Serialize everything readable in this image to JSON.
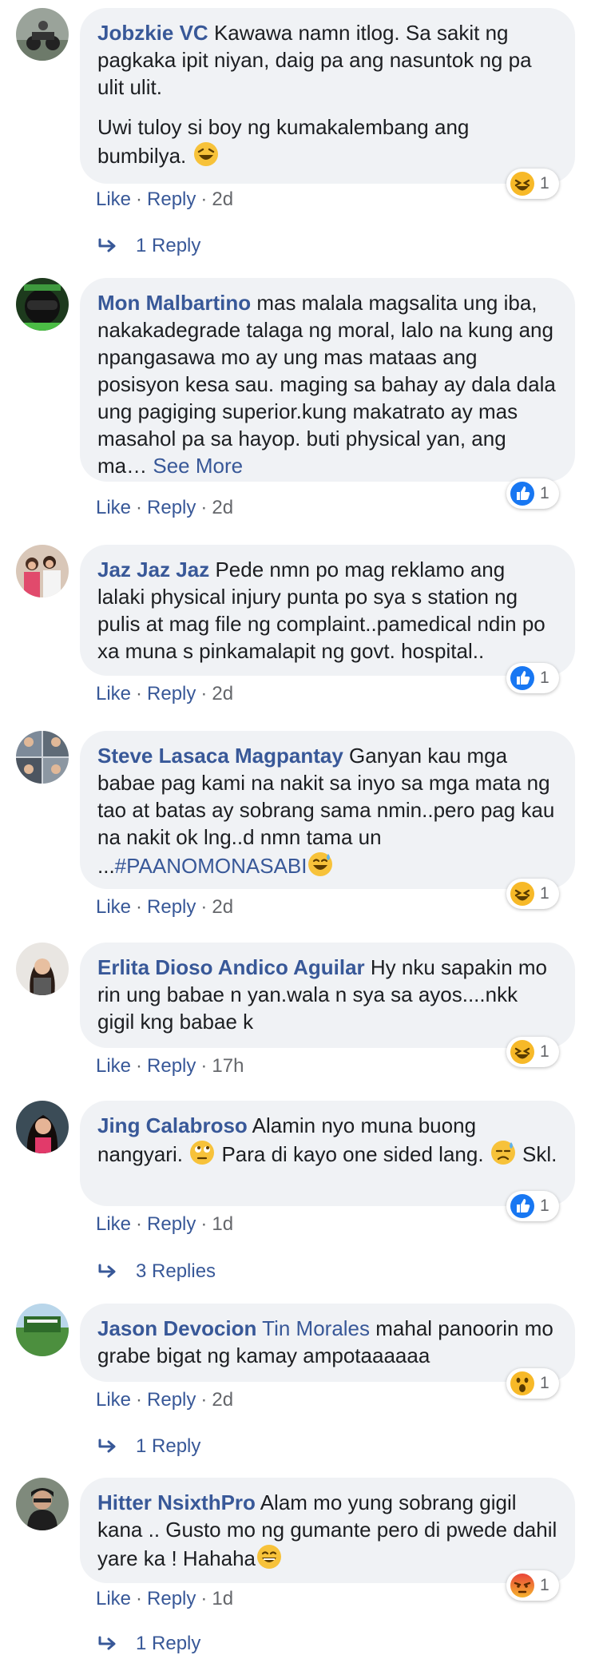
{
  "comments": [
    {
      "author": "Jobzkie VC",
      "mention": "",
      "text": "Kawawa namn itlog. Sa sakit ng pagkaka ipit niyan, daig pa ang nasuntok ng pa ulit ulit.",
      "text2": "Uwi tuloy si boy ng kumakalembang ang bumbilya.",
      "see_more": "",
      "like": "Like",
      "reply": "Reply",
      "time": "2d",
      "reaction": {
        "type": "haha",
        "count": "1"
      },
      "replies": "1 Reply"
    },
    {
      "author": "Mon Malbartino",
      "mention": "",
      "text": "mas malala magsalita ung iba, nakakadegrade talaga ng moral, lalo na kung ang npangasawa mo ay ung mas mataas ang posisyon kesa sau. maging sa bahay ay dala dala ung pagiging superior.kung makatrato ay mas masahol pa sa hayop. buti physical yan, ang ma…",
      "see_more": "See More",
      "like": "Like",
      "reply": "Reply",
      "time": "2d",
      "reaction": {
        "type": "like",
        "count": "1"
      },
      "replies": ""
    },
    {
      "author": "Jaz Jaz Jaz",
      "mention": "",
      "text": "Pede nmn po mag reklamo ang lalaki physical injury punta po sya s station ng pulis at mag file ng complaint..pamedical ndin po xa muna s pinkamalapit ng govt. hospital..",
      "see_more": "",
      "like": "Like",
      "reply": "Reply",
      "time": "2d",
      "reaction": {
        "type": "like",
        "count": "1"
      },
      "replies": ""
    },
    {
      "author": "Steve Lasaca Magpantay",
      "mention": "",
      "text": "Ganyan kau mga babae pag kami na nakit sa inyo sa mga mata ng tao at batas ay sobrang sama nmin..pero pag kau na nakit ok lng..d nmn tama un ...",
      "hashtag": "#PAANOMONASABI",
      "see_more": "",
      "like": "Like",
      "reply": "Reply",
      "time": "2d",
      "reaction": {
        "type": "haha",
        "count": "1"
      },
      "replies": ""
    },
    {
      "author": "Erlita Dioso Andico Aguilar",
      "mention": "",
      "text": "Hy nku sapakin mo rin ung babae n yan.wala n sya sa ayos....nkk gigil kng babae k",
      "see_more": "",
      "like": "Like",
      "reply": "Reply",
      "time": "17h",
      "reaction": {
        "type": "haha",
        "count": "1"
      },
      "replies": ""
    },
    {
      "author": "Jing Calabroso",
      "mention": "",
      "text_a": "Alamin nyo muna buong nangyari.",
      "text_b": "Para di kayo one sided lang.",
      "text_c": "Skl.",
      "see_more": "",
      "like": "Like",
      "reply": "Reply",
      "time": "1d",
      "reaction": {
        "type": "like",
        "count": "1"
      },
      "replies": "3 Replies"
    },
    {
      "author": "Jason Devocion",
      "mention": "Tin Morales",
      "text": "mahal panoorin mo grabe bigat ng kamay ampotaaaaaa",
      "see_more": "",
      "like": "Like",
      "reply": "Reply",
      "time": "2d",
      "reaction": {
        "type": "wow",
        "count": "1"
      },
      "replies": "1 Reply"
    },
    {
      "author": "Hitter NsixthPro",
      "mention": "",
      "text": "Alam mo yung sobrang gigil kana .. Gusto mo ng gumante pero di pwede dahil yare ka ! Hahaha",
      "see_more": "",
      "like": "Like",
      "reply": "Reply",
      "time": "1d",
      "reaction": {
        "type": "angry",
        "count": "1"
      },
      "replies": "1 Reply"
    }
  ],
  "colors": {
    "link": "#385898",
    "bubble": "#f0f2f5",
    "meta": "#65676b",
    "like_blue": "#1877f2",
    "haha_yellow": "#f7b928",
    "angry_red": "#e9710f"
  }
}
